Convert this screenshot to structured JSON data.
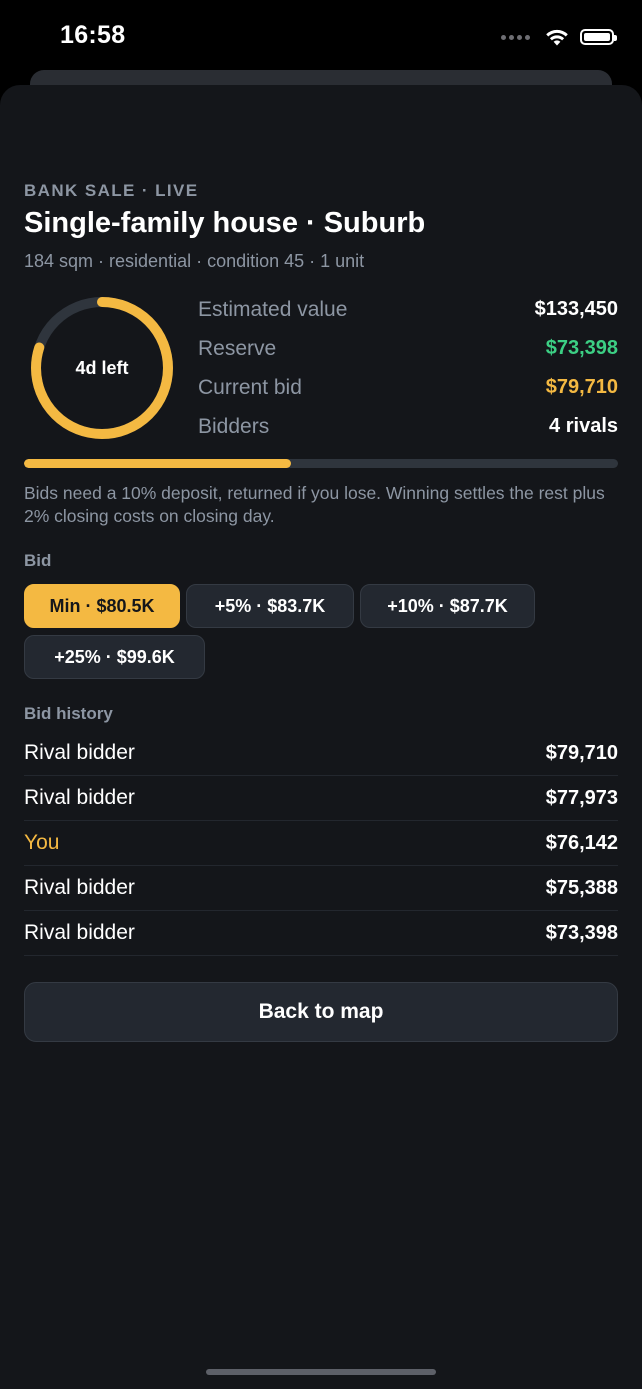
{
  "status_bar": {
    "time": "16:58"
  },
  "listing": {
    "eyebrow": "BANK SALE · LIVE",
    "title": "Single-family house · Suburb",
    "subtitle": "184 sqm · residential · condition 45 · 1 unit"
  },
  "timer": {
    "label": "4d left",
    "remaining_fraction": 0.8,
    "color": "#f4b942",
    "track_color": "#2f353d"
  },
  "stats": [
    {
      "label": "Estimated value",
      "value": "$133,450",
      "color": "#ffffff"
    },
    {
      "label": "Reserve",
      "value": "$73,398",
      "color": "#3ccf84"
    },
    {
      "label": "Current bid",
      "value": "$79,710",
      "color": "#f4b942"
    },
    {
      "label": "Bidders",
      "value": "4 rivals",
      "color": "#ffffff"
    }
  ],
  "progress": {
    "fraction": 0.45
  },
  "note": "Bids need a 10% deposit, returned if you lose. Winning settles the rest plus 2% closing costs on closing day.",
  "bid": {
    "section_label": "Bid",
    "options": [
      {
        "label": "Min · $80.5K",
        "selected": true
      },
      {
        "label": "+5% · $83.7K",
        "selected": false
      },
      {
        "label": "+10% · $87.7K",
        "selected": false
      },
      {
        "label": "+25% · $99.6K",
        "selected": false
      }
    ]
  },
  "history": {
    "section_label": "Bid history",
    "rows": [
      {
        "name": "Rival bidder",
        "amount": "$79,710",
        "is_you": false
      },
      {
        "name": "Rival bidder",
        "amount": "$77,973",
        "is_you": false
      },
      {
        "name": "You",
        "amount": "$76,142",
        "is_you": true
      },
      {
        "name": "Rival bidder",
        "amount": "$75,388",
        "is_you": false
      },
      {
        "name": "Rival bidder",
        "amount": "$73,398",
        "is_you": false
      }
    ]
  },
  "actions": {
    "back_label": "Back to map"
  },
  "colors": {
    "accent": "#f4b942",
    "positive": "#3ccf84",
    "background": "#14161a",
    "muted_text": "#8d96a3"
  }
}
